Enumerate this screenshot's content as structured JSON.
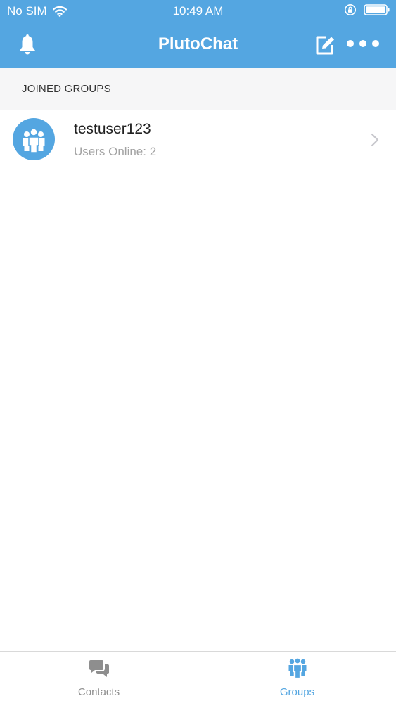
{
  "status_bar": {
    "carrier": "No SIM",
    "time": "10:49 AM",
    "icons": [
      "wifi-icon",
      "orientation-lock-icon",
      "battery-icon"
    ]
  },
  "navbar": {
    "title": "PlutoChat",
    "left_icon": "bell-icon",
    "right_icons": [
      "compose-icon",
      "more-icon"
    ]
  },
  "section": {
    "header": "JOINED GROUPS"
  },
  "groups": [
    {
      "name": "testuser123",
      "subtitle": "Users Online: 2",
      "icon": "group-icon"
    }
  ],
  "tabbar": {
    "tabs": [
      {
        "label": "Contacts",
        "icon": "chat-bubbles-icon",
        "selected": false
      },
      {
        "label": "Groups",
        "icon": "group-icon",
        "selected": true
      }
    ]
  },
  "colors": {
    "brand": "#54a6e1",
    "inactive_tab": "#8e8e8e",
    "subtitle": "#a3a3a3"
  }
}
